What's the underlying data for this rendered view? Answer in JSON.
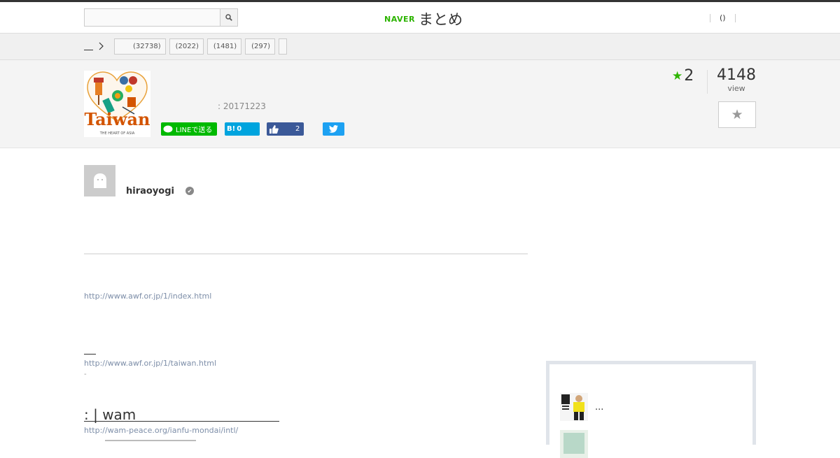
{
  "header": {
    "search": {
      "value": "",
      "placeholder": ""
    },
    "logo": {
      "brand": "NAVER",
      "name": "まとめ"
    },
    "right_link": "()"
  },
  "breadcrumb": {
    "tags": [
      {
        "label": "",
        "count": "(32738)"
      },
      {
        "label": "",
        "count": "(2022)"
      },
      {
        "label": "",
        "count": "(1481)"
      },
      {
        "label": "",
        "count": "(297)"
      },
      {
        "label": "",
        "count": ""
      }
    ]
  },
  "summary": {
    "thumbnail": {
      "title": "Taiwan",
      "subtitle": "THE HEART OF ASIA"
    },
    "date": ": 20171223",
    "share": {
      "line_label": "LINEで送る",
      "hatena_label": "B!",
      "hatena_count": "0",
      "facebook_count": "2"
    },
    "favorites": "2",
    "views": "4148",
    "views_label": "view"
  },
  "author": {
    "name": "hiraoyogi"
  },
  "content": {
    "link1": "http://www.awf.or.jp/1/index.html",
    "link2": "http://www.awf.or.jp/1/taiwan.html",
    "link2_sub": "-",
    "section_title": ":  |  wam",
    "link3": "http://wam-peace.org/ianfu-mondai/intl/"
  },
  "sidebar": {
    "items": [
      {
        "text": "..."
      },
      {
        "text": ""
      }
    ]
  },
  "colors": {
    "brand_green": "#2db400",
    "link": "#7d8ea8"
  }
}
